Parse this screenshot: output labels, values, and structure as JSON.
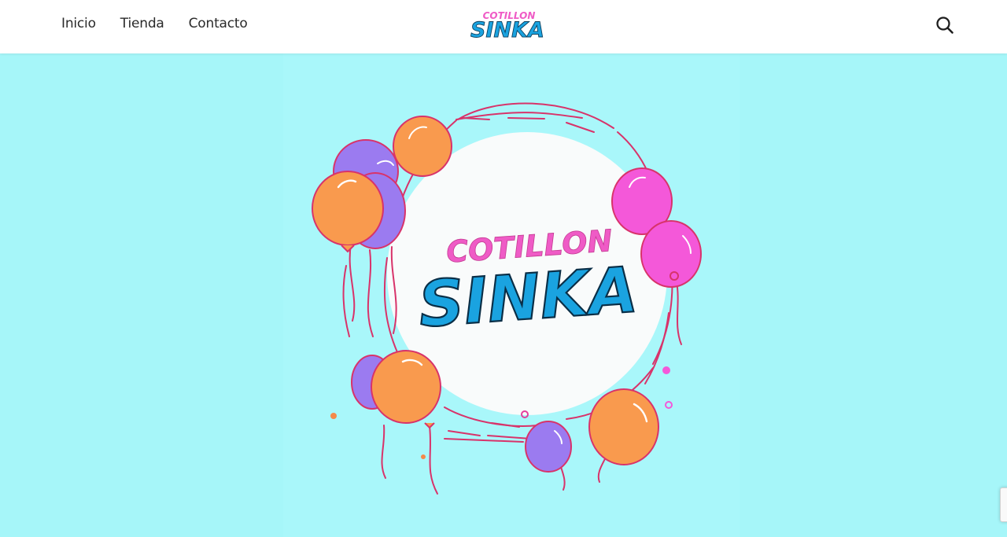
{
  "nav": {
    "items": [
      {
        "label": "Inicio",
        "icon": ""
      },
      {
        "label": "Tienda",
        "icon": ""
      },
      {
        "label": "Contacto",
        "icon": ""
      }
    ]
  },
  "header": {
    "logo_line1": "COTILLON",
    "logo_line2": "SINKA",
    "search_icon": "search-icon"
  },
  "hero": {
    "logo_line1": "COTILLON",
    "logo_line2": "SINKA"
  },
  "colors": {
    "background": "#a6f6f9",
    "pink": "#ef5bc6",
    "blue": "#1aa3e0",
    "orange": "#f99a4e",
    "purple": "#9b7bf0",
    "magenta": "#f458d9",
    "line": "#d8336a"
  },
  "icons": {
    "recaptcha": "recaptcha-icon"
  }
}
